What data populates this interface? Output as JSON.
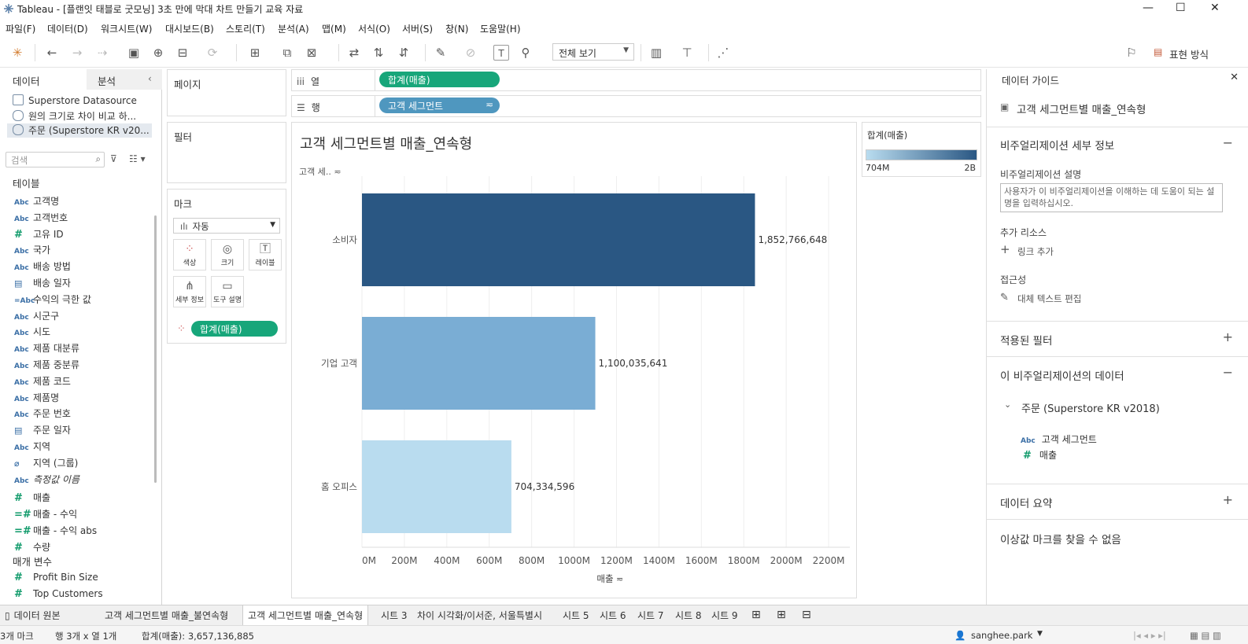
{
  "window": {
    "title": "Tableau - [플랜잇 태블로 굿모닝] 3초 만에 막대 차트 만들기 교육 자료"
  },
  "menu": [
    "파일(F)",
    "데이터(D)",
    "워크시트(W)",
    "대시보드(B)",
    "스토리(T)",
    "분석(A)",
    "맵(M)",
    "서식(O)",
    "서버(S)",
    "창(N)",
    "도움말(H)"
  ],
  "toolbar": {
    "view_select": "전체 보기",
    "show_me": "표현 방식"
  },
  "left_panel": {
    "tab_data": "데이터",
    "tab_analytics": "분석",
    "datasources": [
      "Superstore Datasource",
      "원의 크기로 차이 비교 하...",
      "주문 (Superstore KR v20..."
    ],
    "search_placeholder": "검색",
    "tables_label": "테이블",
    "fields": [
      {
        "type": "Abc",
        "name": "고객명"
      },
      {
        "type": "Abc",
        "name": "고객번호"
      },
      {
        "type": "#",
        "name": "고유 ID"
      },
      {
        "type": "Abc",
        "name": "국가"
      },
      {
        "type": "Abc",
        "name": "배송 방법"
      },
      {
        "type": "date",
        "name": "배송 일자"
      },
      {
        "type": "=Abc",
        "name": "수익의 극한 값"
      },
      {
        "type": "Abc",
        "name": "시군구"
      },
      {
        "type": "Abc",
        "name": "시도"
      },
      {
        "type": "Abc",
        "name": "제품 대분류"
      },
      {
        "type": "Abc",
        "name": "제품 중분류"
      },
      {
        "type": "Abc",
        "name": "제품 코드"
      },
      {
        "type": "Abc",
        "name": "제품명"
      },
      {
        "type": "Abc",
        "name": "주문 번호"
      },
      {
        "type": "date",
        "name": "주문 일자"
      },
      {
        "type": "Abc",
        "name": "지역"
      },
      {
        "type": "clip",
        "name": "지역 (그룹)"
      },
      {
        "type": "Abc",
        "name": "측정값 이름"
      },
      {
        "type": "#",
        "name": "매출"
      },
      {
        "type": "=#",
        "name": "매출 - 수익"
      },
      {
        "type": "=#",
        "name": "매출 - 수익 abs"
      },
      {
        "type": "#",
        "name": "수량"
      }
    ],
    "params_label": "매개 변수",
    "params": [
      {
        "type": "#",
        "name": "Profit Bin Size"
      },
      {
        "type": "#",
        "name": "Top Customers"
      }
    ]
  },
  "cards": {
    "pages": "페이지",
    "filters": "필터",
    "marks": "마크",
    "mark_type": "자동",
    "mark_buttons": [
      "색상",
      "크기",
      "레이블",
      "세부 정보",
      "도구 설명"
    ],
    "color_pill": "합계(매출)"
  },
  "shelves": {
    "columns_label": "열",
    "columns_pill": "합계(매출)",
    "rows_label": "행",
    "rows_pill": "고객 세그먼트"
  },
  "viz": {
    "title": "고객 세그먼트별 매출_연속형",
    "row_header": "고객 세.."
  },
  "legend": {
    "title": "합계(매출)",
    "min": "704M",
    "max": "2B",
    "color_start": "#b9dcef",
    "color_end": "#2a5783"
  },
  "chart_data": {
    "type": "bar",
    "orientation": "horizontal",
    "categories": [
      "소비자",
      "기업 고객",
      "홈 오피스"
    ],
    "values": [
      1852766648,
      1100035641,
      704334596
    ],
    "labels": [
      "1,852,766,648",
      "1,100,035,641",
      "704,334,596"
    ],
    "colors": [
      "#2a5783",
      "#7aadd4",
      "#b9dcef"
    ],
    "xlabel": "매출",
    "ylabel": "고객 세..",
    "xlim": [
      0,
      2300000000
    ],
    "xticks": [
      "0M",
      "200M",
      "400M",
      "600M",
      "800M",
      "1000M",
      "1200M",
      "1400M",
      "1600M",
      "1800M",
      "2000M",
      "2200M"
    ],
    "grid": true
  },
  "guide": {
    "title": "데이터 가이드",
    "sheet": "고객 세그먼트별 매출_연속형",
    "details_header": "비주얼리제이션 세부 정보",
    "desc_label": "비주얼리제이션 설명",
    "desc_placeholder": "사용자가 이 비주얼리제이션을 이해하는 데 도움이 되는 설명을 입력하십시오.",
    "resources_label": "추가 리소스",
    "add_link": "링크 추가",
    "access_label": "접근성",
    "alt_text": "대체 텍스트 편집",
    "filters_header": "적용된 필터",
    "data_header": "이 비주얼리제이션의 데이터",
    "datasource": "주문 (Superstore KR v2018)",
    "data_fields": [
      {
        "type": "Abc",
        "name": "고객 세그먼트"
      },
      {
        "type": "#",
        "name": "매출"
      }
    ],
    "summary_header": "데이터 요약",
    "outlier": "이상값 마크를 찾을 수 없음"
  },
  "sheet_tabs": [
    "데이터 원본",
    "고객 세그먼트별 매출_불연속형",
    "고객 세그먼트별 매출_연속형",
    "시트 3",
    "차이 시각화/이서준, 서울특별시",
    "시트 5",
    "시트 6",
    "시트 7",
    "시트 8",
    "시트 9"
  ],
  "status": {
    "marks": "3개 마크",
    "rows_cols": "행 3개 x 열 1개",
    "sum": "합계(매출): 3,657,136,885",
    "user": "sanghee.park"
  }
}
